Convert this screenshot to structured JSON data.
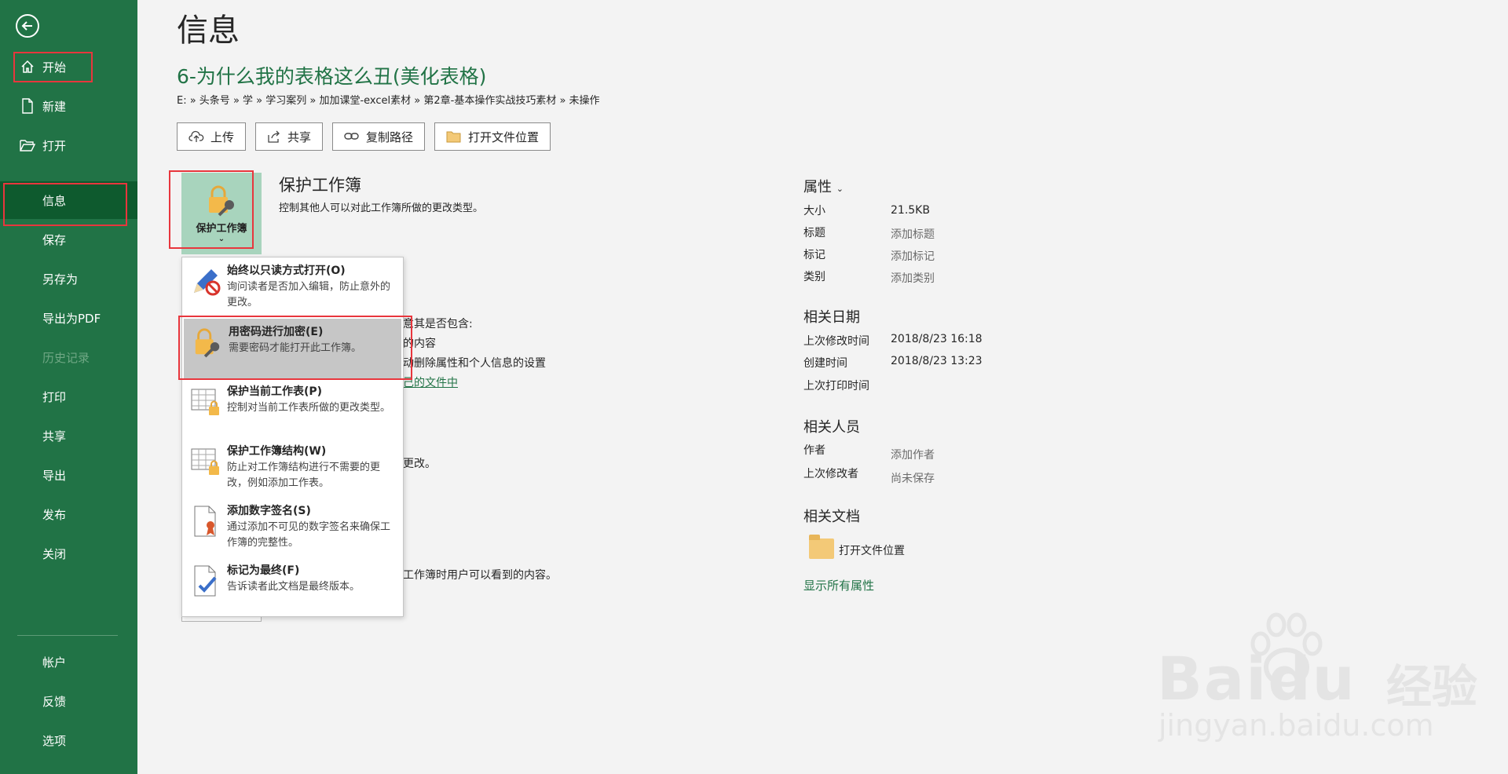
{
  "sidebar": {
    "items": [
      {
        "label": "开始",
        "icon": "home-icon"
      },
      {
        "label": "新建",
        "icon": "new-document-icon"
      },
      {
        "label": "打开",
        "icon": "open-folder-icon"
      },
      {
        "label": "信息"
      },
      {
        "label": "保存"
      },
      {
        "label": "另存为"
      },
      {
        "label": "导出为PDF"
      },
      {
        "label": "历史记录"
      },
      {
        "label": "打印"
      },
      {
        "label": "共享"
      },
      {
        "label": "导出"
      },
      {
        "label": "发布"
      },
      {
        "label": "关闭"
      }
    ],
    "bottom": [
      {
        "label": "帐户"
      },
      {
        "label": "反馈"
      },
      {
        "label": "选项"
      }
    ]
  },
  "header": {
    "title": "信息",
    "doc_title": "6-为什么我的表格这么丑(美化表格)",
    "path": "E: » 头条号 » 学 » 学习案列 » 加加课堂-excel素材 » 第2章-基本操作实战技巧素材 » 未操作"
  },
  "actions": [
    "上传",
    "共享",
    "复制路径",
    "打开文件位置"
  ],
  "protect": {
    "tile_label": "保护工作簿",
    "heading": "保护工作簿",
    "description": "控制其他人可以对此工作簿所做的更改类型。"
  },
  "background_text": {
    "line1": "意其是否包含:",
    "line2": "的内容",
    "line3": "动删除属性和个人信息的设置",
    "line4": "己的文件中",
    "line5": "更改。",
    "line6": "工作簿时用户可以看到的内容。"
  },
  "dropdown": [
    {
      "title": "始终以只读方式打开(O)",
      "desc": "询问读者是否加入编辑，防止意外的更改。"
    },
    {
      "title": "用密码进行加密(E)",
      "desc": "需要密码才能打开此工作簿。"
    },
    {
      "title": "保护当前工作表(P)",
      "desc": "控制对当前工作表所做的更改类型。"
    },
    {
      "title": "保护工作簿结构(W)",
      "desc": "防止对工作簿结构进行不需要的更改，例如添加工作表。"
    },
    {
      "title": "添加数字签名(S)",
      "desc": "通过添加不可见的数字签名来确保工作簿的完整性。"
    },
    {
      "title": "标记为最终(F)",
      "desc": "告诉读者此文档是最终版本。"
    }
  ],
  "properties": {
    "heading": "属性",
    "size_label": "大小",
    "size_value": "21.5KB",
    "title_label": "标题",
    "title_value": "添加标题",
    "tags_label": "标记",
    "tags_value": "添加标记",
    "category_label": "类别",
    "category_value": "添加类别"
  },
  "dates": {
    "heading": "相关日期",
    "modified_label": "上次修改时间",
    "modified_value": "2018/8/23 16:18",
    "created_label": "创建时间",
    "created_value": "2018/8/23 13:23",
    "printed_label": "上次打印时间"
  },
  "people": {
    "heading": "相关人员",
    "author_label": "作者",
    "author_value": "添加作者",
    "modifier_label": "上次修改者",
    "modifier_value": "尚未保存"
  },
  "docs": {
    "heading": "相关文档",
    "open_location": "打开文件位置",
    "show_all": "显示所有属性"
  },
  "watermark": {
    "brand": "Baidu",
    "brand_cn": "经验",
    "url": "jingyan.baidu.com"
  },
  "colors": {
    "accent": "#217346",
    "highlight_box": "#e8363d"
  }
}
